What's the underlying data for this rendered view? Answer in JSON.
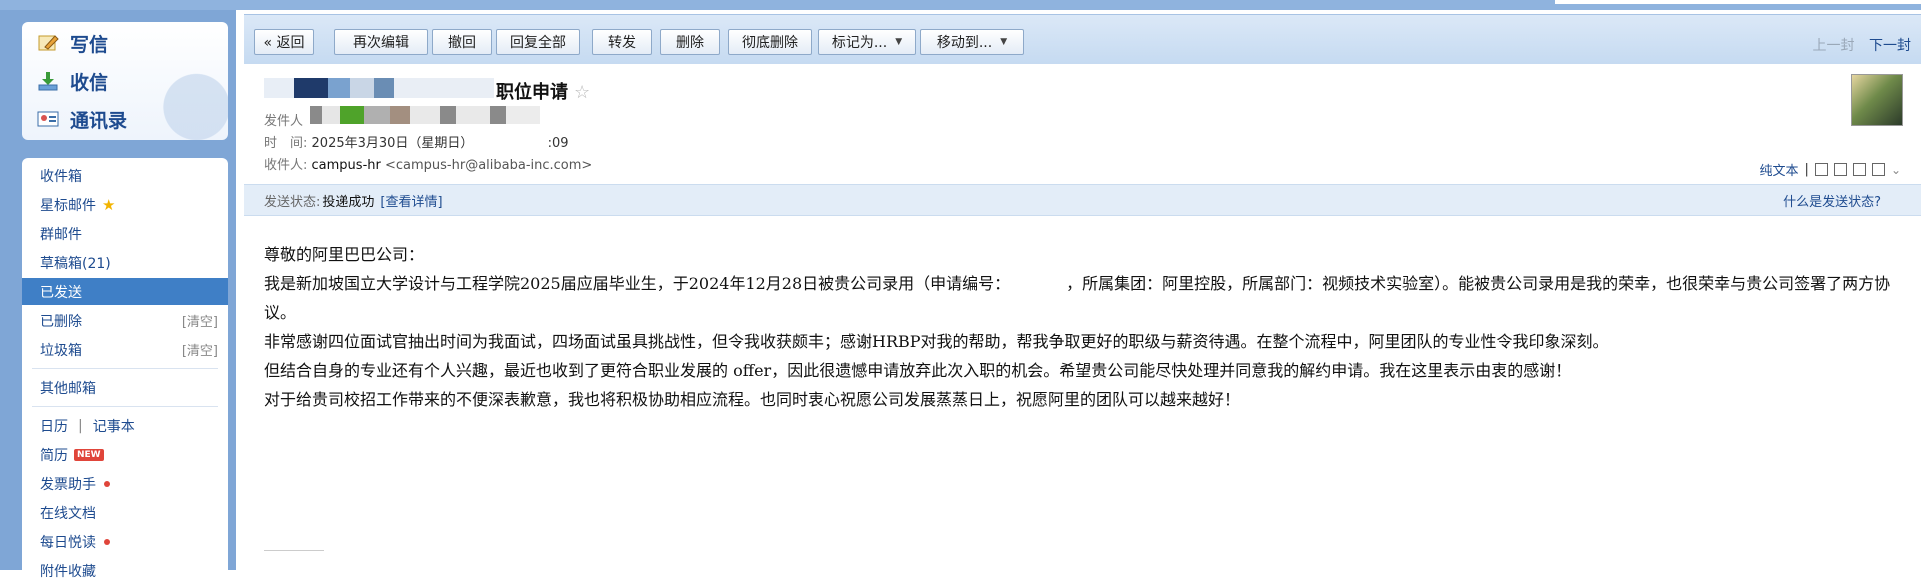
{
  "sidebar": {
    "compose": {
      "write": "写信",
      "receive": "收信",
      "contacts": "通讯录"
    },
    "folders": [
      {
        "label": "收件箱"
      },
      {
        "label": "星标邮件"
      },
      {
        "label": "群邮件"
      },
      {
        "label": "草稿箱(21)"
      },
      {
        "label": "已发送"
      },
      {
        "label": "已删除",
        "action": "[清空]"
      },
      {
        "label": "垃圾箱",
        "action": "[清空]"
      },
      {
        "label": "其他邮箱"
      }
    ],
    "tools": {
      "calendar": "日历",
      "divider": "|",
      "notes": "记事本",
      "resume": "简历",
      "resume_badge": "NEW",
      "invoice": "发票助手",
      "docs": "在线文档",
      "daily": "每日悦读",
      "attachments": "附件收藏"
    }
  },
  "toolbar": {
    "back": "« 返回",
    "reedit": "再次编辑",
    "recall": "撤回",
    "reply_all": "回复全部",
    "forward": "转发",
    "delete": "删除",
    "delete_perm": "彻底删除",
    "mark_as": "标记为...",
    "move_to": "移动到...",
    "prev": "上一封",
    "next": "下一封"
  },
  "header": {
    "subject_visible": "职位申请",
    "from_label": "发件人",
    "time_label": "时　间:",
    "time_value": "2025年3月30日（星期日）",
    "time_tail": ":09",
    "to_label": "收件人:",
    "to_name": "campus-hr",
    "to_addr": "<campus-hr@alibaba-inc.com>",
    "plain_text": "纯文本",
    "divider": "|"
  },
  "status": {
    "label": "发送状态:",
    "value": "投递成功",
    "details": "[查看详情]",
    "what": "什么是发送状态?"
  },
  "email_body": {
    "greeting": "尊敬的阿里巴巴公司：",
    "p1": "我是新加坡国立大学设计与工程学院2025届应届毕业生，于2024年12月28日被贵公司录用（申请编号：　　　　，所属集团：阿里控股，所属部门：视频技术实验室）。能被贵公司录用是我的荣幸，也很荣幸与贵公司签署了两方协议。",
    "p2": "非常感谢四位面试官抽出时间为我面试，四场面试虽具挑战性，但令我收获颇丰；感谢HRBP对我的帮助，帮我争取更好的职级与薪资待遇。在整个流程中，阿里团队的专业性令我印象深刻。",
    "p3": "但结合自身的专业还有个人兴趣，最近也收到了更符合职业发展的 offer，因此很遗憾申请放弃此次入职的机会。希望贵公司能尽快处理并同意我的解约申请。我在这里表示由衷的感谢！",
    "p4": "对于给贵司校招工作带来的不便深表歉意，我也将积极协助相应流程。也同时衷心祝愿公司发展蒸蒸日上，祝愿阿里的团队可以越来越好！"
  },
  "colors": {
    "sidebar_bg": "#7fa6d6",
    "active_folder": "#3f7fc6",
    "link": "#1e4b8f",
    "status_bg": "#e3edf8"
  },
  "icons": [
    "pencil-icon",
    "inbox-download-icon",
    "contacts-card-icon",
    "star-icon",
    "star-outline-icon",
    "caret-down-icon",
    "new-window-icon",
    "print-icon",
    "expand-icon"
  ]
}
